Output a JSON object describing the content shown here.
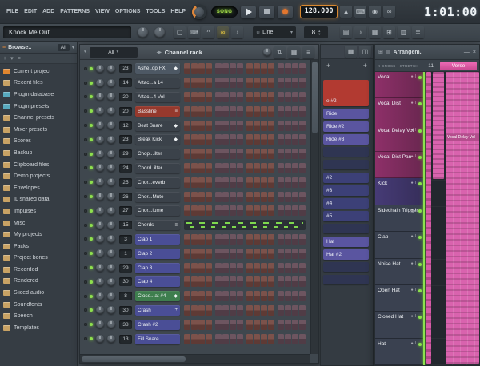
{
  "icons": {
    "burger": "≡",
    "dropdown": "▾",
    "up": "▴",
    "left_right": "◂▸",
    "plus": "+",
    "metronome": "▲",
    "typing_keyboard": "⌨",
    "blend_recording": "◉",
    "loop_recording": "∞",
    "grid": "▦",
    "tiles": "▤",
    "rows": "▥",
    "detach": "◫",
    "swap": "⇅",
    "mixer": "⊞",
    "note": "♪",
    "magnet": "∪",
    "monitor": "▢",
    "caret": "^",
    "link": "∞",
    "list": "≣",
    "close": "×",
    "minimize": "—",
    "dot": "●",
    "fader": "Ι"
  },
  "menubar": {
    "items": [
      "FILE",
      "EDIT",
      "ADD",
      "PATTERNS",
      "VIEW",
      "OPTIONS",
      "TOOLS",
      "HELP"
    ]
  },
  "transport": {
    "mode": "SONG",
    "tempo": "128.000",
    "time": "1:01:00"
  },
  "toolbar": {
    "project_title": "Knock Me Out",
    "snap_value": "Line",
    "multi_value": "8"
  },
  "browser": {
    "title": "Browse..",
    "tab": "All",
    "items": [
      {
        "label": "Current project",
        "color": "#e0862f"
      },
      {
        "label": "Recent files",
        "color": "#c8a264"
      },
      {
        "label": "Plugin database",
        "color": "#58aabe"
      },
      {
        "label": "Plugin presets",
        "color": "#58aabe"
      },
      {
        "label": "Channel presets",
        "color": "#c8a264"
      },
      {
        "label": "Mixer presets",
        "color": "#c8a264"
      },
      {
        "label": "Scores",
        "color": "#c8a264"
      },
      {
        "label": "Backup",
        "color": "#c8a264"
      },
      {
        "label": "Clipboard files",
        "color": "#c8a264"
      },
      {
        "label": "Demo projects",
        "color": "#c8a264"
      },
      {
        "label": "Envelopes",
        "color": "#c8a264"
      },
      {
        "label": "IL shared data",
        "color": "#c8a264"
      },
      {
        "label": "Impulses",
        "color": "#c8a264"
      },
      {
        "label": "Misc",
        "color": "#c8a264"
      },
      {
        "label": "My projects",
        "color": "#c8a264"
      },
      {
        "label": "Packs",
        "color": "#c8a264"
      },
      {
        "label": "Project bones",
        "color": "#c8a264"
      },
      {
        "label": "Recorded",
        "color": "#c8a264"
      },
      {
        "label": "Rendered",
        "color": "#c8a264"
      },
      {
        "label": "Sliced audio",
        "color": "#c8a264"
      },
      {
        "label": "Soundfonts",
        "color": "#c8a264"
      },
      {
        "label": "Speech",
        "color": "#c8a264"
      },
      {
        "label": "Templates",
        "color": "#c8a264"
      }
    ]
  },
  "channel_rack": {
    "title": "Channel rack",
    "filter": "All",
    "channels": [
      {
        "num": "23",
        "name": "Ashe..op FX",
        "color": "#4d5864",
        "type": "steps",
        "icon": "◆"
      },
      {
        "num": "14",
        "name": "Attac...a 14",
        "color": "#3b424a",
        "type": "steps"
      },
      {
        "num": "20",
        "name": "Attac...4 Vol",
        "color": "#3b424a",
        "type": "steps"
      },
      {
        "num": "20",
        "name": "Bassline",
        "color": "#96392d",
        "type": "steps",
        "icon": "≡"
      },
      {
        "num": "12",
        "name": "Beat Snare",
        "color": "#3b424a",
        "type": "steps",
        "icon": "◆"
      },
      {
        "num": "23",
        "name": "Break Kick",
        "color": "#3b424a",
        "type": "steps",
        "icon": "◆"
      },
      {
        "num": "29",
        "name": "Chop...ilter",
        "color": "#3b424a",
        "type": "steps"
      },
      {
        "num": "24",
        "name": "Chord..ilter",
        "color": "#3b424a",
        "type": "steps"
      },
      {
        "num": "25",
        "name": "Chor...everb",
        "color": "#3b424a",
        "type": "steps"
      },
      {
        "num": "26",
        "name": "Chor...Mute",
        "color": "#3b424a",
        "type": "steps"
      },
      {
        "num": "27",
        "name": "Chor...lume",
        "color": "#3b424a",
        "type": "steps"
      },
      {
        "num": "15",
        "name": "Chords",
        "color": "#3b424a",
        "type": "preview",
        "icon": "≡"
      },
      {
        "num": "3",
        "name": "Clap 1",
        "color": "#4a4e96",
        "type": "steps"
      },
      {
        "num": "1",
        "name": "Clap 2",
        "color": "#4a4e96",
        "type": "steps"
      },
      {
        "num": "29",
        "name": "Clap 3",
        "color": "#4a4e96",
        "type": "steps"
      },
      {
        "num": "30",
        "name": "Clap 4",
        "color": "#4a4e96",
        "type": "steps"
      },
      {
        "num": "8",
        "name": "Close...at #4",
        "color": "#3e7e4e",
        "type": "steps",
        "icon": "◆"
      },
      {
        "num": "30",
        "name": "Crash",
        "color": "#4a4e96",
        "type": "steps",
        "icon": "+"
      },
      {
        "num": "38",
        "name": "Crash #2",
        "color": "#4a4e96",
        "type": "steps"
      },
      {
        "num": "13",
        "name": "Fill Snare",
        "color": "#4a4e96",
        "type": "steps"
      }
    ]
  },
  "picker": {
    "items": [
      {
        "label": "e #2",
        "color": "#b23a31",
        "cls": "tall"
      },
      {
        "label": "Ride",
        "color": "#5a55a0"
      },
      {
        "label": "Ride #2",
        "color": "#5a55a0"
      },
      {
        "label": "Ride #3",
        "color": "#5a55a0"
      },
      {
        "label": "",
        "color": "#2f3552",
        "cls": "spacer"
      },
      {
        "label": "",
        "color": "#2f3552",
        "cls": "spacer"
      },
      {
        "label": "#2",
        "color": "#3c4077"
      },
      {
        "label": "#3",
        "color": "#3c4077"
      },
      {
        "label": "#4",
        "color": "#3c4077"
      },
      {
        "label": "#5",
        "color": "#3c4077"
      },
      {
        "label": "",
        "color": "#2f3552",
        "cls": "spacer"
      },
      {
        "label": "Hat",
        "color": "#5a55a0"
      },
      {
        "label": "Hat #2",
        "color": "#5a55a0"
      },
      {
        "label": "",
        "color": "#2f3552",
        "cls": "spacer"
      },
      {
        "label": "",
        "color": "#2f3552",
        "cls": "spacer"
      }
    ]
  },
  "playlist": {
    "title": "Arrangem..",
    "fade_label": "X-CROSS",
    "stretch_label": "STRETCH",
    "bar_number": "11",
    "marker_label": "Verse",
    "clip_label": "Vocal Delay Vol",
    "tracks": [
      {
        "name": "Vocal",
        "group": "vocal"
      },
      {
        "name": "Vocal Dist",
        "group": "vocal"
      },
      {
        "name": "Vocal Delay Vol",
        "group": "vocal"
      },
      {
        "name": "Vocal Dist Pan",
        "group": "vocal"
      },
      {
        "name": "Kick",
        "group": "kick"
      },
      {
        "name": "Sidechain Trigger",
        "group": "plain"
      },
      {
        "name": "Clap",
        "group": "plain"
      },
      {
        "name": "Noise Hat",
        "group": "plain"
      },
      {
        "name": "Open Hat",
        "group": "plain"
      },
      {
        "name": "Closed Hat",
        "group": "plain"
      },
      {
        "name": "Hat",
        "group": "plain"
      }
    ]
  }
}
